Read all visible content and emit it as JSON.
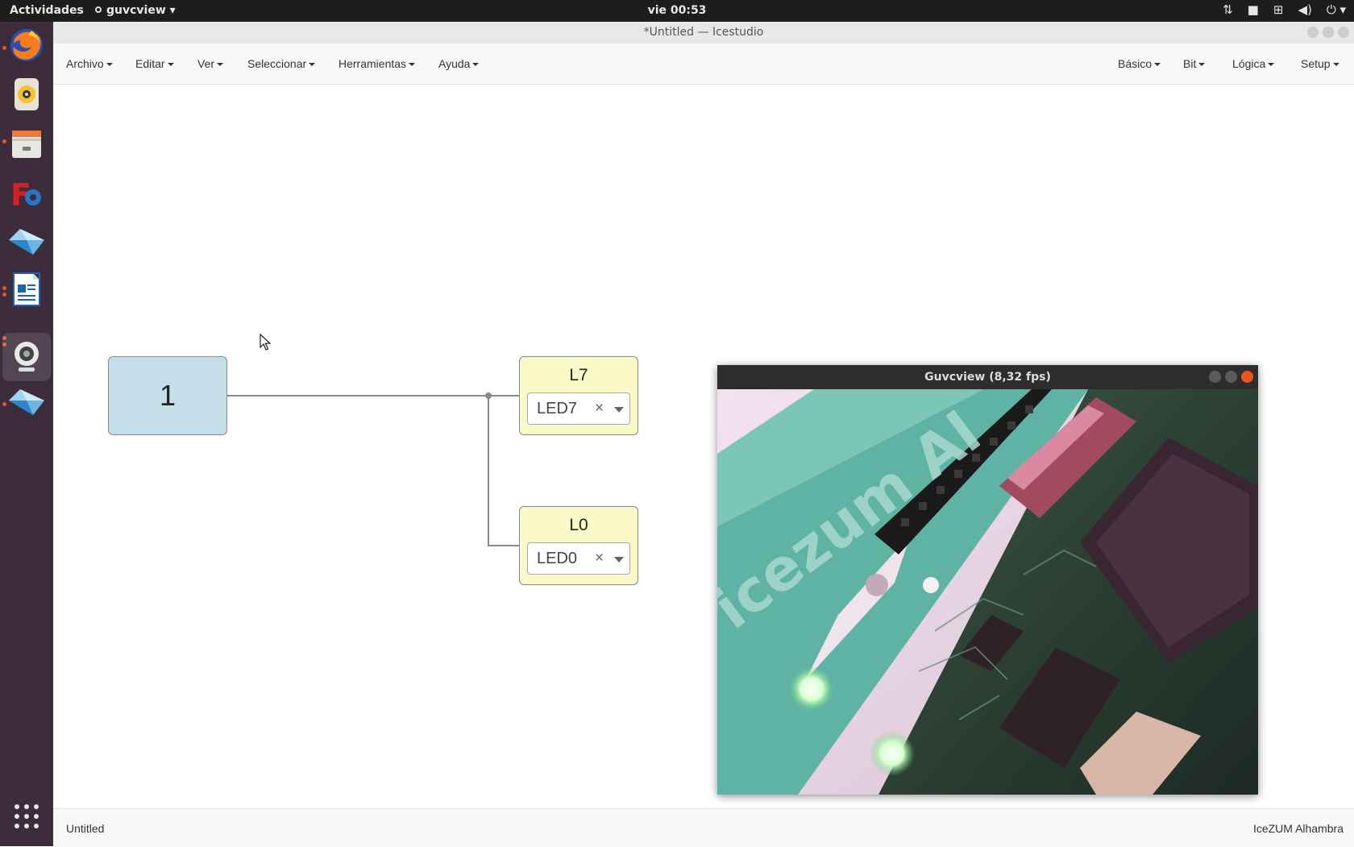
{
  "topbar": {
    "activities": "Actividades",
    "app_menu": "guvcview",
    "clock": "vie 00:53",
    "tray_icons": [
      "network-transfer-icon",
      "camera-icon",
      "network-icon",
      "volume-icon",
      "power-icon"
    ]
  },
  "window": {
    "title": "*Untitled — Icestudio"
  },
  "dock": {
    "items": [
      "firefox-icon",
      "rhythmbox-icon",
      "files-icon",
      "freecad-icon",
      "icestudio-icon",
      "writer-icon",
      "webcam-icon",
      "icestudio-icon-2",
      "show-apps-icon"
    ]
  },
  "menubar": {
    "left": [
      "Archivo",
      "Editar",
      "Ver",
      "Seleccionar",
      "Herramientas",
      "Ayuda"
    ],
    "right": [
      "Básico",
      "Bit",
      "Lógica",
      "Setup"
    ]
  },
  "canvas": {
    "constant_block": {
      "value": "1"
    },
    "output_blocks": [
      {
        "label": "L7",
        "pin": "LED7"
      },
      {
        "label": "L0",
        "pin": "LED0"
      }
    ],
    "clear_glyph": "×"
  },
  "guvcview": {
    "title": "Guvcview  (8,32 fps)",
    "camera_text": "icezum Al"
  },
  "statusbar": {
    "left": "Untitled",
    "right": "IceZUM Alhambra"
  },
  "colors": {
    "constant_fill": "#c5dfea",
    "output_fill": "#fafac8",
    "dock_bg": "#3d2c3c",
    "accent": "#e95420"
  }
}
